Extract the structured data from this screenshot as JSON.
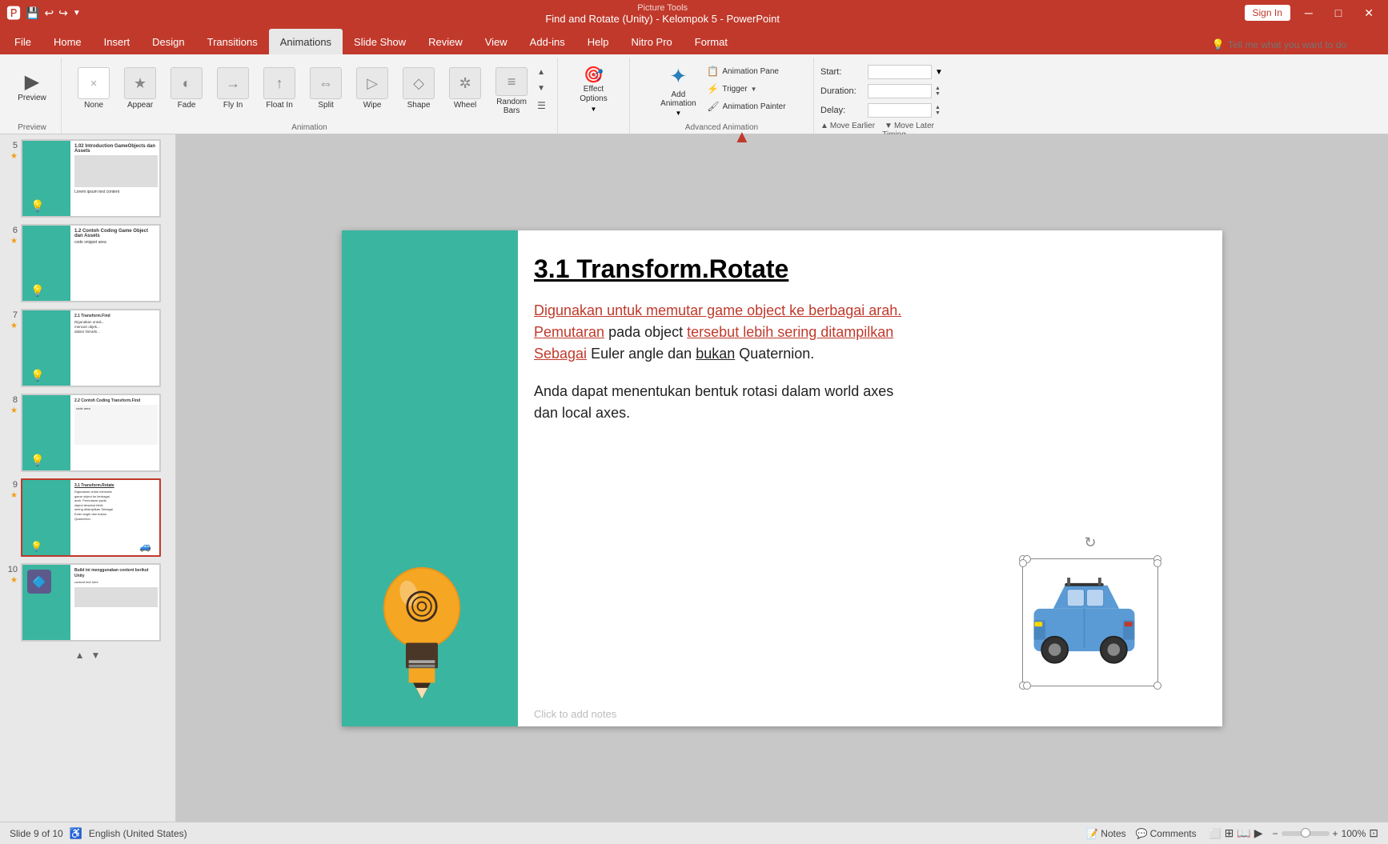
{
  "titlebar": {
    "title": "Find and Rotate (Unity) - Kelompok 5 - PowerPoint",
    "picture_tools": "Picture Tools",
    "sign_in": "Sign In",
    "save_icon": "💾",
    "undo_icon": "↩",
    "redo_icon": "↪"
  },
  "tabs": {
    "file": "File",
    "home": "Home",
    "insert": "Insert",
    "design": "Design",
    "transitions": "Transitions",
    "animations": "Animations",
    "slideshow": "Slide Show",
    "review": "Review",
    "view": "View",
    "addins": "Add-ins",
    "help": "Help",
    "nitro": "Nitro Pro",
    "format": "Format",
    "active": "Animations"
  },
  "ribbon": {
    "preview_label": "Preview",
    "preview_icon": "▶",
    "animation_group_label": "Animation",
    "animations": [
      {
        "id": "none",
        "label": "None",
        "icon": "✕",
        "style": "none"
      },
      {
        "id": "appear",
        "label": "Appear",
        "icon": "★",
        "style": "appear"
      },
      {
        "id": "fade",
        "label": "Fade",
        "icon": "◐",
        "style": "fade"
      },
      {
        "id": "fly_in",
        "label": "Fly In",
        "icon": "→",
        "style": "fly"
      },
      {
        "id": "float_in",
        "label": "Float In",
        "icon": "↑",
        "style": "float"
      },
      {
        "id": "split",
        "label": "Split",
        "icon": "⇔",
        "style": "split"
      },
      {
        "id": "wipe",
        "label": "Wipe",
        "icon": "▷",
        "style": "wipe"
      },
      {
        "id": "shape",
        "label": "Shape",
        "icon": "◇",
        "style": "shape"
      },
      {
        "id": "wheel",
        "label": "Wheel",
        "icon": "✲",
        "style": "wheel"
      },
      {
        "id": "random_bars",
        "label": "Random Bars",
        "icon": "≡",
        "style": "random"
      }
    ],
    "effect_options_label": "Effect\nOptions",
    "effect_options_icon": "▼",
    "add_animation_label": "Add\nAnimation",
    "animation_pane_label": "Animation Pane",
    "trigger_label": "Trigger",
    "animation_painter_label": "Animation Painter",
    "advanced_animation_label": "Advanced Animation",
    "start_label": "Start:",
    "duration_label": "Duration:",
    "delay_label": "Delay:",
    "timing_label": "Timing",
    "reorder_earlier": "Move Earlier",
    "reorder_later": "Move Later",
    "tell_me": "Tell me what you want to do"
  },
  "slides": [
    {
      "num": "5",
      "star": true,
      "active": false,
      "label": "Slide 5"
    },
    {
      "num": "6",
      "star": true,
      "active": false,
      "label": "Slide 6"
    },
    {
      "num": "7",
      "star": true,
      "active": false,
      "label": "Slide 7"
    },
    {
      "num": "8",
      "star": true,
      "active": false,
      "label": "Slide 8"
    },
    {
      "num": "9",
      "star": true,
      "active": true,
      "label": "Slide 9 - Active"
    },
    {
      "num": "10",
      "star": true,
      "active": false,
      "label": "Slide 10"
    }
  ],
  "slide_content": {
    "title": "3.1 Transform.Rotate",
    "para1_parts": [
      {
        "text": "Digunakan untuk memutar game object ke berbagai arah.",
        "underline": true,
        "red": true
      },
      " ",
      {
        "text": "Pemutaran",
        "underline": true,
        "red": true
      },
      {
        "text": " pada object ",
        "underline": false,
        "red": false
      },
      {
        "text": "tersebut lebih sering ditampilkan",
        "underline": true,
        "red": true
      },
      {
        "text": " ",
        "underline": false
      },
      {
        "text": "Sebagai",
        "underline": true,
        "red": true
      },
      {
        "text": " Euler angle dan ",
        "underline": false
      },
      {
        "text": "bukan",
        "underline": true
      },
      {
        "text": " Quaternion.",
        "underline": false
      }
    ],
    "para1_line1": "Digunakan untuk memutar game object ke berbagai arah.",
    "para1_line2": "Pemutaran pada object tersebut lebih sering ditampilkan",
    "para1_line3": "Sebagai Euler angle dan bukan Quaternion.",
    "para2_line1": "Anda dapat menentukan bentuk rotasi dalam world axes",
    "para2_line2": "dan local axes.",
    "click_to_add_notes": "Click to add notes"
  },
  "statusbar": {
    "slide_info": "Slide 9 of 10",
    "language": "English (United States)",
    "notes_label": "Notes",
    "comments_label": "Comments",
    "accessibility_icon": "♿"
  },
  "colors": {
    "accent_red": "#c0392b",
    "teal": "#3ab5a0",
    "animation_green": "#82b366",
    "animation_green_bg": "#d5e8d4"
  }
}
